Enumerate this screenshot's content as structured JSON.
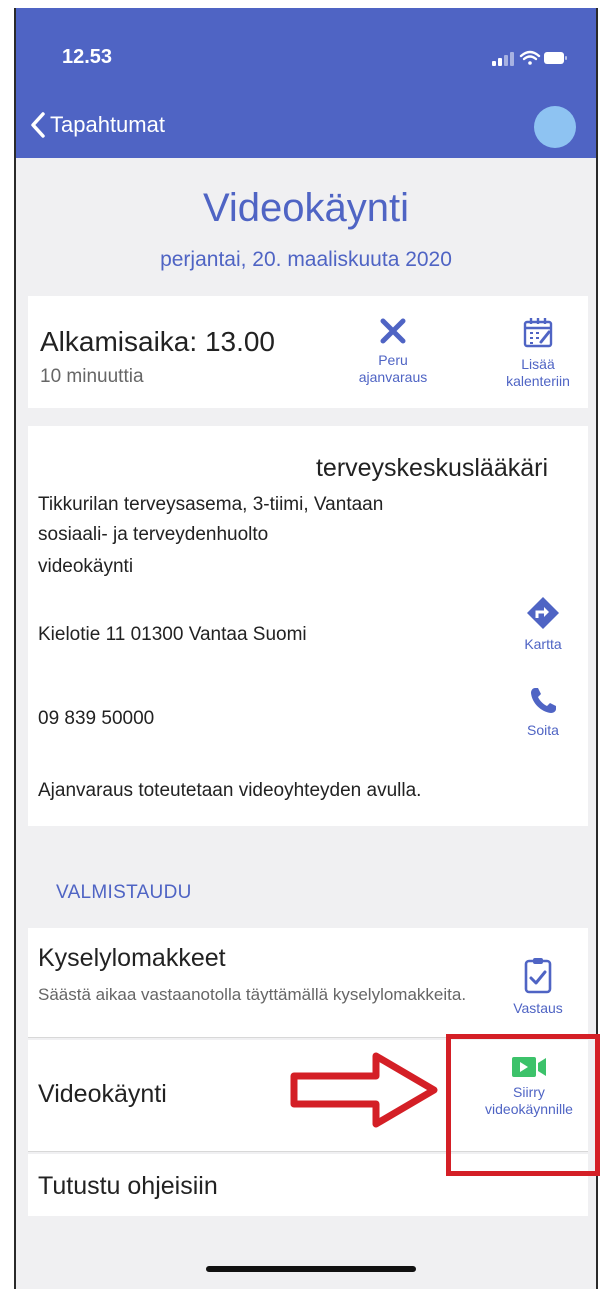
{
  "status_bar": {
    "time": "12.53",
    "icons": [
      "signal-icon",
      "wifi-icon",
      "battery-icon"
    ]
  },
  "nav": {
    "back_label": "Tapahtumat"
  },
  "appointment": {
    "title": "Videokäynti",
    "date": "perjantai, 20. maaliskuuta 2020",
    "start_time": "Alkamisaika: 13.00",
    "duration": "10 minuuttia",
    "cancel_label": "Peru ajanvaraus",
    "calendar_label": "Lisää kalenteriin"
  },
  "details": {
    "provider": "terveyskeskuslääkäri",
    "clinic": "Tikkurilan terveysasema, 3-tiimi, Vantaan sosiaali- ja terveydenhuolto",
    "visit_type": "videokäynti",
    "address": "Kielotie 11 01300 Vantaa Suomi",
    "map_label": "Kartta",
    "phone": "09 839 50000",
    "call_label": "Soita",
    "note": "Ajanvaraus toteutetaan videoyhteyden avulla."
  },
  "prepare": {
    "section_label": "VALMISTAUDU",
    "forms": {
      "title": "Kyselylomakkeet",
      "description": "Säästä aikaa vastaanotolla täyttämällä kyselylomakkeita.",
      "action_label": "Vastaus"
    },
    "video": {
      "title": "Videokäynti",
      "action_label": "Siirry videokäynnille"
    },
    "guide": {
      "title": "Tutustu ohjeisiin"
    }
  },
  "colors": {
    "brand": "#4f64c4",
    "avatar": "#8ec3f2",
    "video_icon": "#3cc26a",
    "annotation": "#d41f26"
  }
}
